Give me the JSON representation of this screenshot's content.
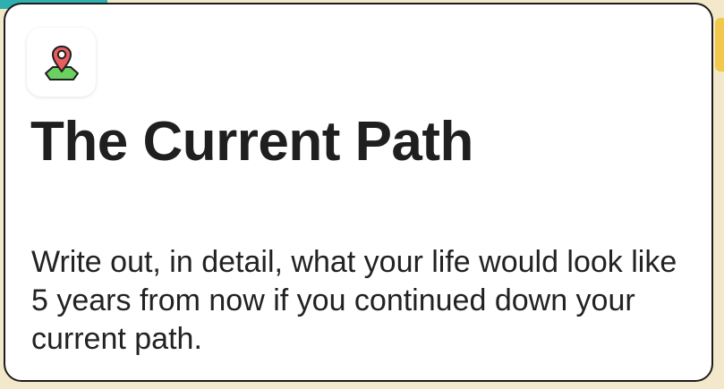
{
  "card": {
    "icon": "map-pin-icon",
    "title": "The Current Path",
    "description": "Write out, in detail, what your life would look like 5 years from now if you continued down your current path."
  },
  "colors": {
    "card_background": "#ffffff",
    "card_border": "#1c1c1c",
    "text": "#222222",
    "pin_red": "#e85d5d",
    "map_green": "#6ccf61"
  }
}
